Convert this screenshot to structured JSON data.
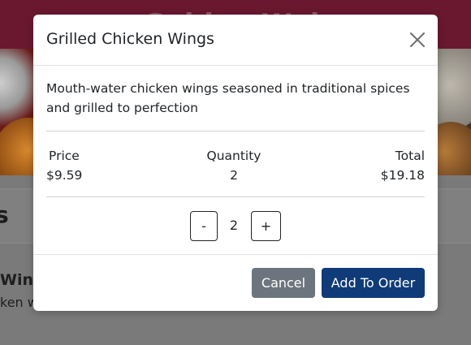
{
  "page": {
    "brand_title": "Golden Wok",
    "section_title": "s",
    "menu_item_name": "Wing",
    "menu_item_desc": "ken w"
  },
  "modal": {
    "title": "Grilled Chicken Wings",
    "close_icon": "close-icon",
    "description": "Mouth-water chicken wings seasoned in traditional spices and grilled to perfection",
    "price_label": "Price",
    "price_value": "$9.59",
    "quantity_label": "Quantity",
    "quantity_value": "2",
    "total_label": "Total",
    "total_value": "$19.18",
    "stepper": {
      "minus_label": "-",
      "value": "2",
      "plus_label": "+"
    },
    "cancel_label": "Cancel",
    "add_label": "Add To Order"
  },
  "colors": {
    "brand": "#6a1830",
    "primary_button": "#0f3b78",
    "secondary_button": "#6c757d"
  }
}
